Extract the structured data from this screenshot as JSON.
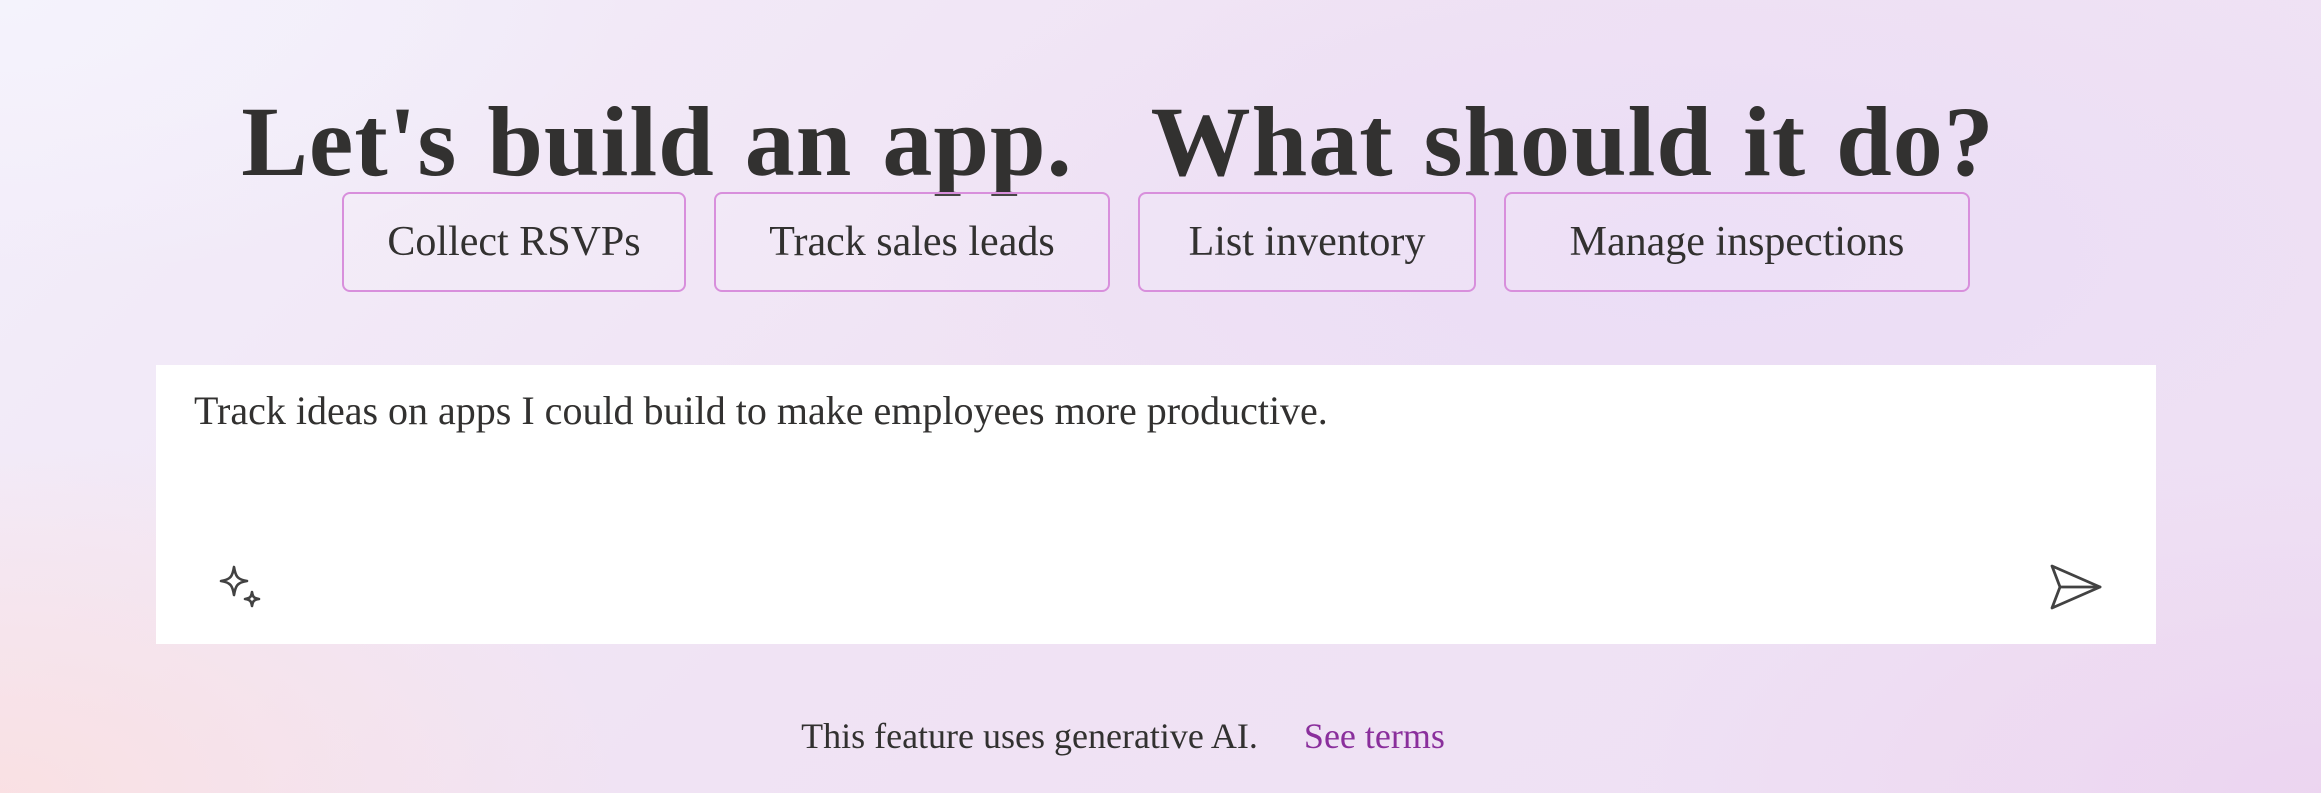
{
  "header": {
    "title_part1": "Let's build an app.",
    "title_part2": "What should it do?"
  },
  "suggestions": [
    {
      "label": "Collect RSVPs"
    },
    {
      "label": "Track sales leads"
    },
    {
      "label": "List inventory"
    },
    {
      "label": "Manage inspections"
    }
  ],
  "prompt": {
    "value": "Track ideas on apps I could build to make employees more productive.",
    "sparkle_icon": "sparkle-icon",
    "send_icon": "send-icon"
  },
  "footer": {
    "disclaimer": "This feature uses generative AI.",
    "link_label": "See terms"
  },
  "colors": {
    "chip_border": "#d88fdc",
    "link": "#8a2f9c",
    "text": "#323130"
  }
}
